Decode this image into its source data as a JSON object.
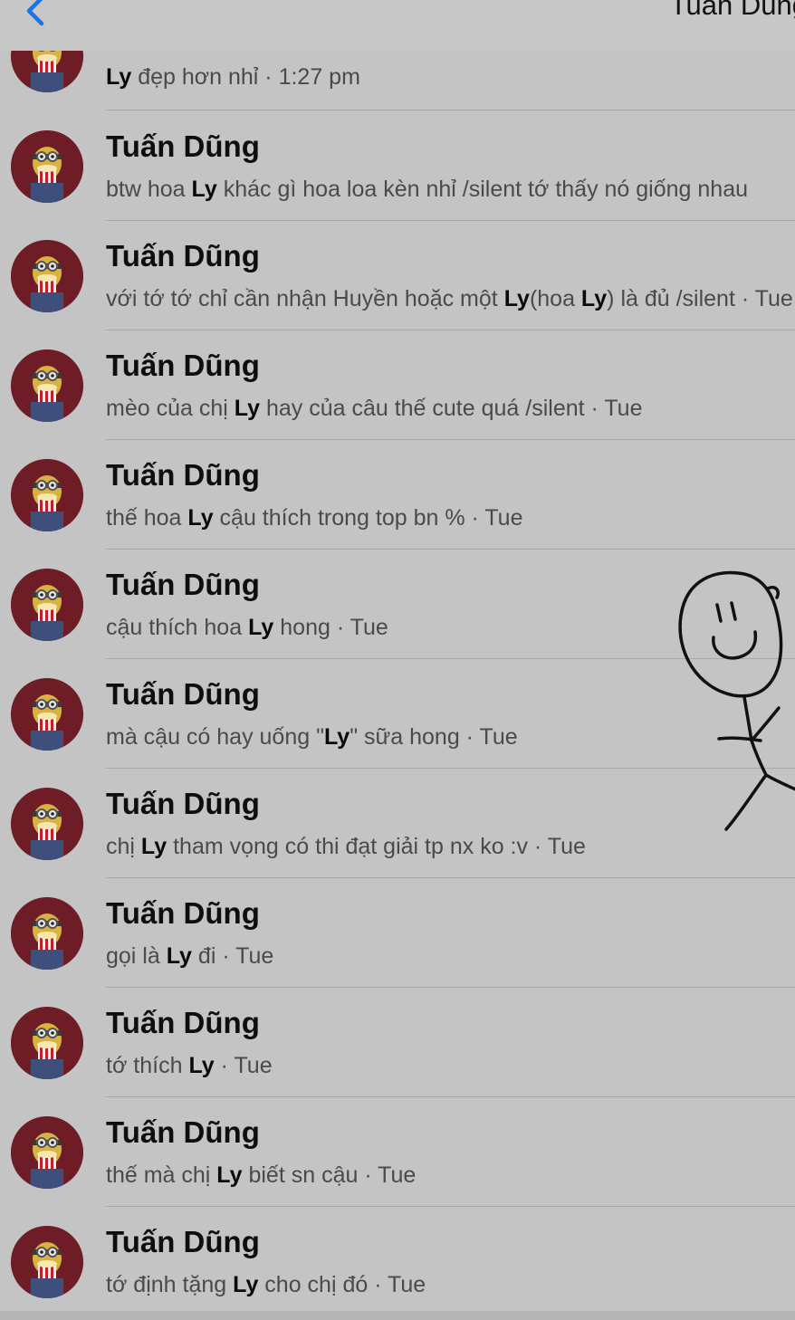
{
  "header": {
    "title": "Tuấn Dũng",
    "back_icon": "chevron-left-icon",
    "accent_color": "#1a73e8"
  },
  "first_row": {
    "term": "Ly",
    "rest": " đẹp hơn nhỉ · 1:27 pm"
  },
  "results": [
    {
      "name": "Tuấn Dũng",
      "parts": [
        "btw hoa ",
        "Ly",
        " khác gì hoa loa kèn nhỉ /silent  tớ thấy nó giống nhau"
      ]
    },
    {
      "name": "Tuấn Dũng",
      "parts": [
        "với tớ tớ chỉ cần nhận Huyền hoặc một ",
        "Ly",
        "(hoa ",
        "Ly",
        ") là đủ /silent · Tue"
      ]
    },
    {
      "name": "Tuấn Dũng",
      "parts": [
        "mèo của chị ",
        "Ly",
        " hay của câu thế cute quá /silent · Tue"
      ]
    },
    {
      "name": "Tuấn Dũng",
      "parts": [
        "thế hoa ",
        "Ly",
        " cậu thích trong top bn % · Tue"
      ]
    },
    {
      "name": "Tuấn Dũng",
      "parts": [
        "cậu thích hoa ",
        "Ly",
        " hong · Tue"
      ]
    },
    {
      "name": "Tuấn Dũng",
      "parts": [
        "mà cậu có hay uống \"",
        "Ly",
        "\" sữa hong · Tue"
      ]
    },
    {
      "name": "Tuấn Dũng",
      "parts": [
        "chị ",
        "Ly",
        " tham vọng có thi đạt giải tp nx ko :v · Tue"
      ]
    },
    {
      "name": "Tuấn Dũng",
      "parts": [
        "gọi là ",
        "Ly",
        " đi · Tue"
      ]
    },
    {
      "name": "Tuấn Dũng",
      "parts": [
        "tớ thích ",
        "Ly",
        " · Tue"
      ]
    },
    {
      "name": "Tuấn Dũng",
      "parts": [
        "thế mà chị ",
        "Ly",
        " biết sn cậu · Tue"
      ]
    },
    {
      "name": "Tuấn Dũng",
      "parts": [
        "tớ định tặng ",
        "Ly",
        " cho chị đó · Tue"
      ]
    }
  ],
  "avatar_icon": "minion-popcorn-avatar-icon",
  "doodle_icon": "smiley-stick-figure-icon"
}
